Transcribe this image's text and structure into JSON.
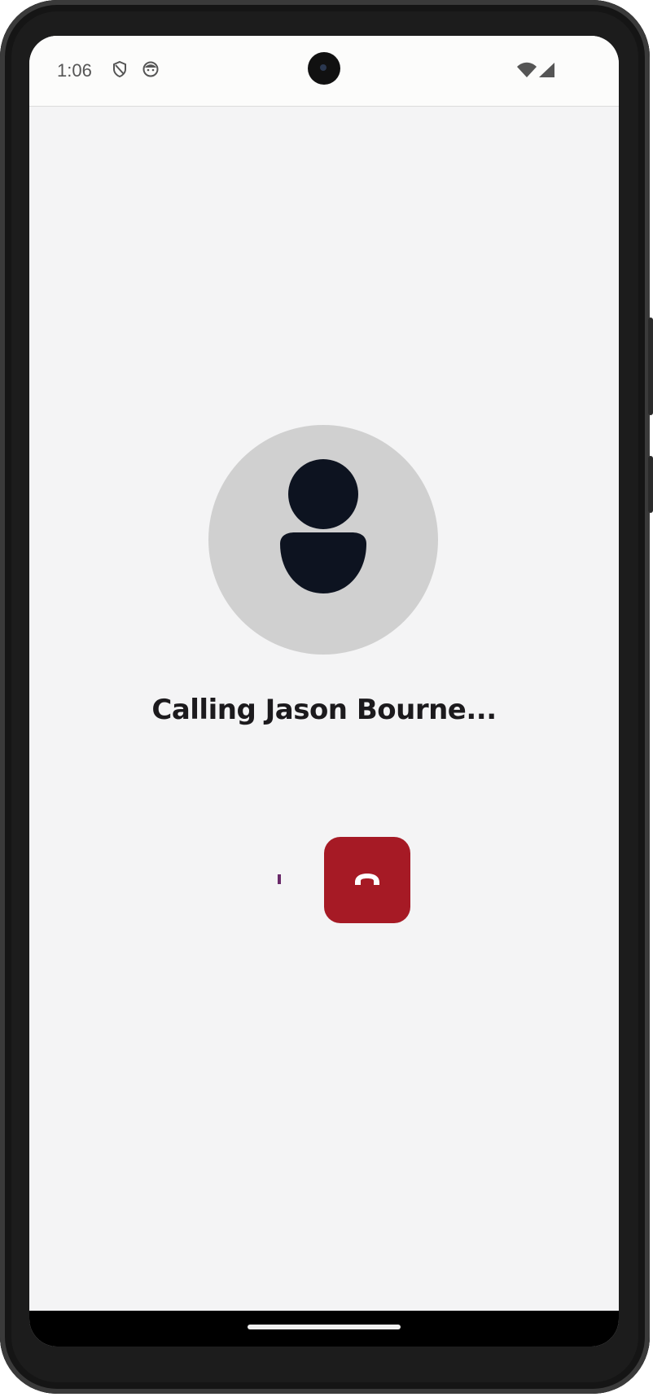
{
  "status_bar": {
    "time": "1:06",
    "icons": [
      "shield-icon",
      "face-icon",
      "wifi-icon",
      "cell-signal-icon"
    ]
  },
  "call": {
    "status_text": "Calling Jason Bourne...",
    "avatar_icon": "person-icon",
    "end_call_icon": "phone-hangup-icon"
  },
  "colors": {
    "background": "#f4f4f5",
    "end_call": "#a61a25",
    "avatar_bg": "#d0d0d0",
    "avatar_fg": "#0d1320"
  },
  "nav": {
    "handle": "home-gesture-handle"
  }
}
